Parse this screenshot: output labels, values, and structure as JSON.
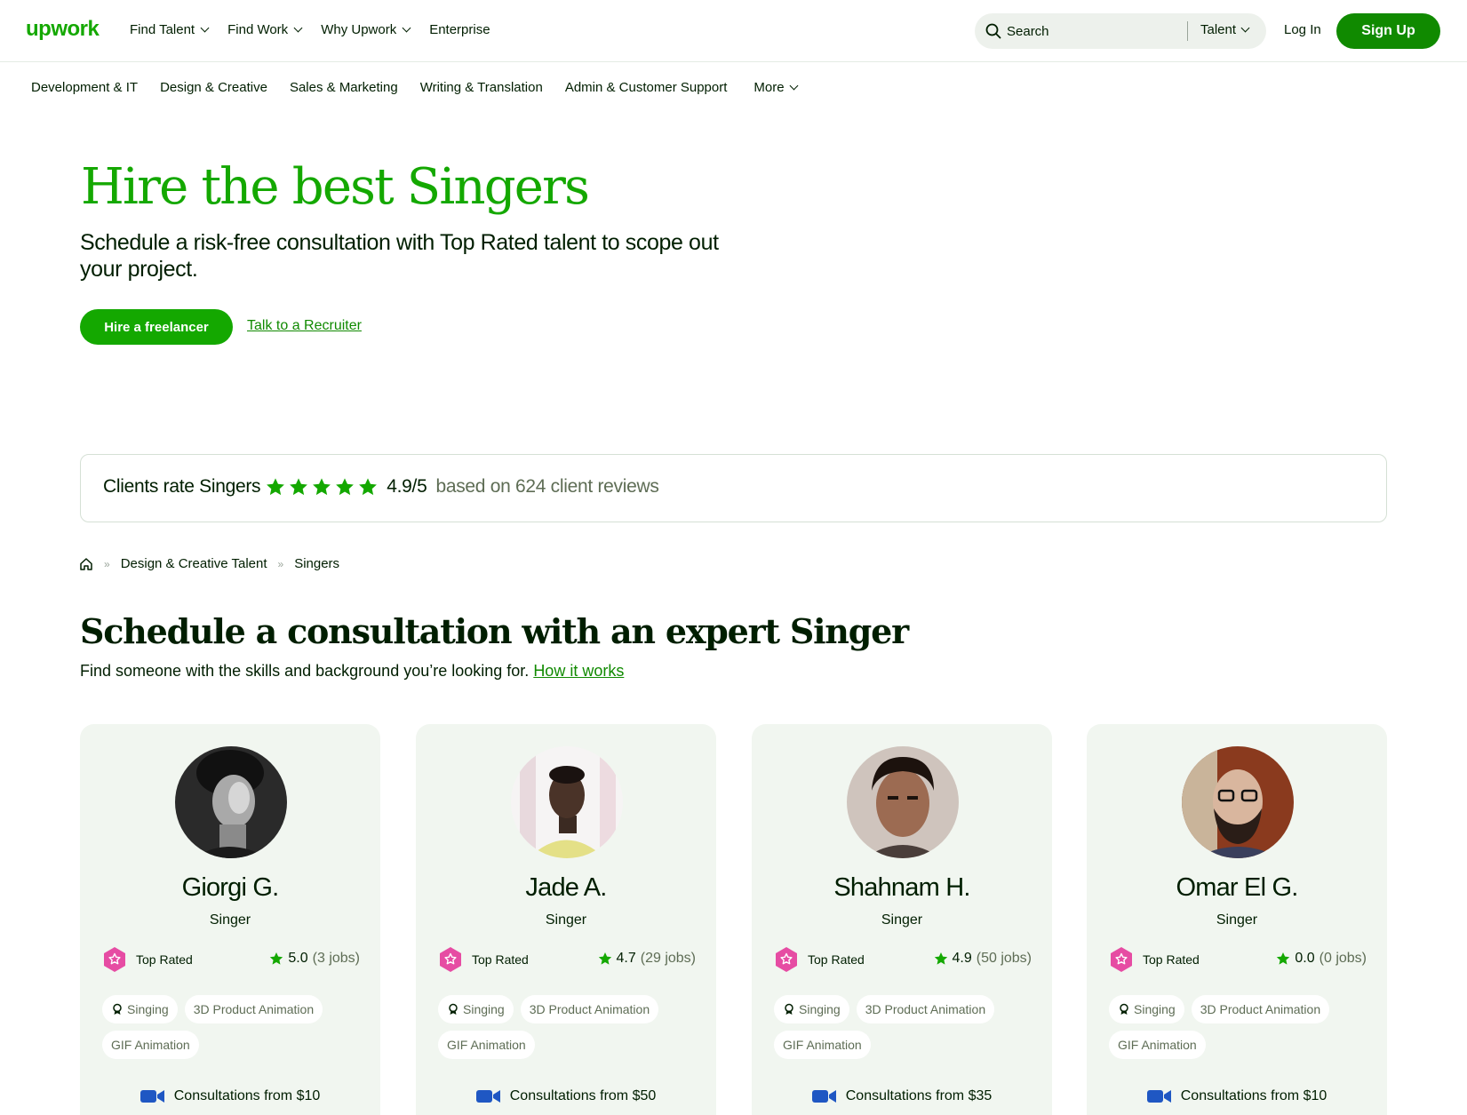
{
  "header": {
    "logo": "upwork",
    "nav": [
      {
        "label": "Find Talent",
        "dropdown": true
      },
      {
        "label": "Find Work",
        "dropdown": true
      },
      {
        "label": "Why Upwork",
        "dropdown": true
      },
      {
        "label": "Enterprise",
        "dropdown": false
      }
    ],
    "search": {
      "placeholder": "Search",
      "scope": "Talent"
    },
    "login": "Log In",
    "signup": "Sign Up"
  },
  "categories": [
    "Development & IT",
    "Design & Creative",
    "Sales & Marketing",
    "Writing & Translation",
    "Admin & Customer Support"
  ],
  "categories_more": "More",
  "hero": {
    "title": "Hire the best Singers",
    "subtitle": "Schedule a risk-free consultation with Top Rated talent to scope out your project.",
    "primary_cta": "Hire a freelancer",
    "secondary_cta": "Talk to a Recruiter"
  },
  "rating_bar": {
    "lead": "Clients rate Singers",
    "stars": 5,
    "score": "4.9/5",
    "reviews": "based on 624 client reviews"
  },
  "breadcrumb": {
    "items": [
      "Design & Creative Talent",
      "Singers"
    ],
    "separator": "»"
  },
  "section": {
    "title": "Schedule a consultation with an expert Singer",
    "subtitle": "Find someone with the skills and background you’re looking for.",
    "link": "How it works"
  },
  "freelancers": [
    {
      "name": "Giorgi G.",
      "role": "Singer",
      "badge": "Top Rated",
      "rating": "5.0",
      "jobs": "(3 jobs)",
      "skills": [
        "Singing",
        "3D Product Animation",
        "GIF Animation"
      ],
      "consultation": "Consultations from $10"
    },
    {
      "name": "Jade A.",
      "role": "Singer",
      "badge": "Top Rated",
      "rating": "4.7",
      "jobs": "(29 jobs)",
      "skills": [
        "Singing",
        "3D Product Animation",
        "GIF Animation"
      ],
      "consultation": "Consultations from $50"
    },
    {
      "name": "Shahnam H.",
      "role": "Singer",
      "badge": "Top Rated",
      "rating": "4.9",
      "jobs": "(50 jobs)",
      "skills": [
        "Singing",
        "3D Product Animation",
        "GIF Animation"
      ],
      "consultation": "Consultations from $35"
    },
    {
      "name": "Omar El G.",
      "role": "Singer",
      "badge": "Top Rated",
      "rating": "0.0",
      "jobs": "(0 jobs)",
      "skills": [
        "Singing",
        "3D Product Animation",
        "GIF Animation"
      ],
      "consultation": "Consultations from $10"
    }
  ],
  "colors": {
    "brand_green": "#14a800",
    "dark_green": "#108a00",
    "text": "#001e00",
    "muted": "#5e6d55",
    "card_bg": "#f1f6f0",
    "badge_pink": "#e64ca3",
    "video_blue": "#1f57c3"
  },
  "icons": {
    "search": "search-icon",
    "home": "home-icon",
    "star": "star-icon",
    "top_rated": "top-rated-badge-icon",
    "skill_verified": "award-icon",
    "consultation": "video-camera-icon"
  }
}
